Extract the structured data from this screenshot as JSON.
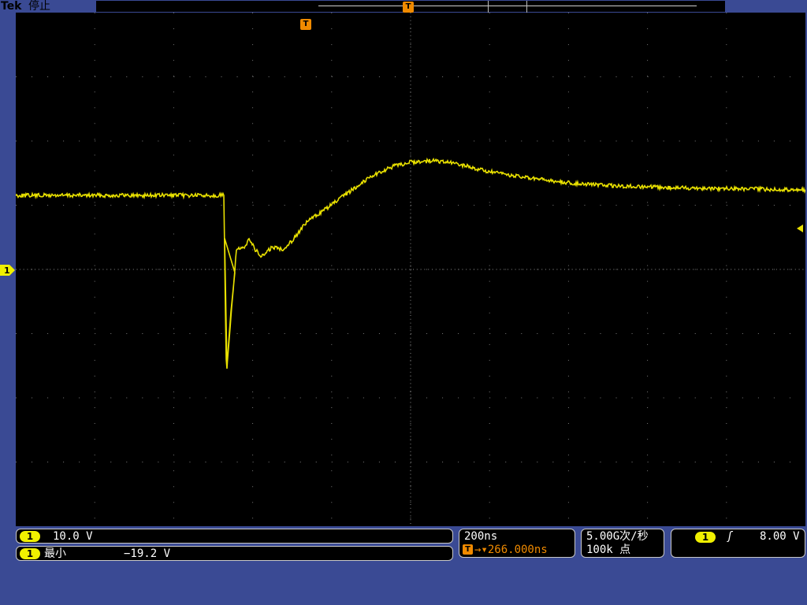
{
  "header": {
    "brand": "Tek",
    "acquisition_state": "停止"
  },
  "markers": {
    "channel": "1",
    "trigger_t": "T",
    "trigger_position": "T"
  },
  "readouts": {
    "channel_scale": {
      "channel": "1",
      "value": "10.0 V"
    },
    "measurement": {
      "channel": "1",
      "label": "最小",
      "value": "−19.2 V"
    },
    "timebase": {
      "scale": "200ns",
      "delay_icon": "T",
      "delay": "→▾266.000ns"
    },
    "sample": {
      "rate": "5.00G次/秒",
      "record": "100k 点"
    },
    "trigger": {
      "channel": "1",
      "slope": "rising",
      "slope_symbol": "ʃ",
      "level": "8.00 V"
    }
  },
  "colors": {
    "trace": "#e8e000",
    "graticule": "#000000",
    "frame": "#3a4a94",
    "accent": "#f08a00",
    "channel_badge": "#f0f000"
  },
  "icons": {
    "ch1_ground_marker": "ch1-ground-marker-icon",
    "trigger_level_marker": "trigger-level-arrow-icon"
  }
}
